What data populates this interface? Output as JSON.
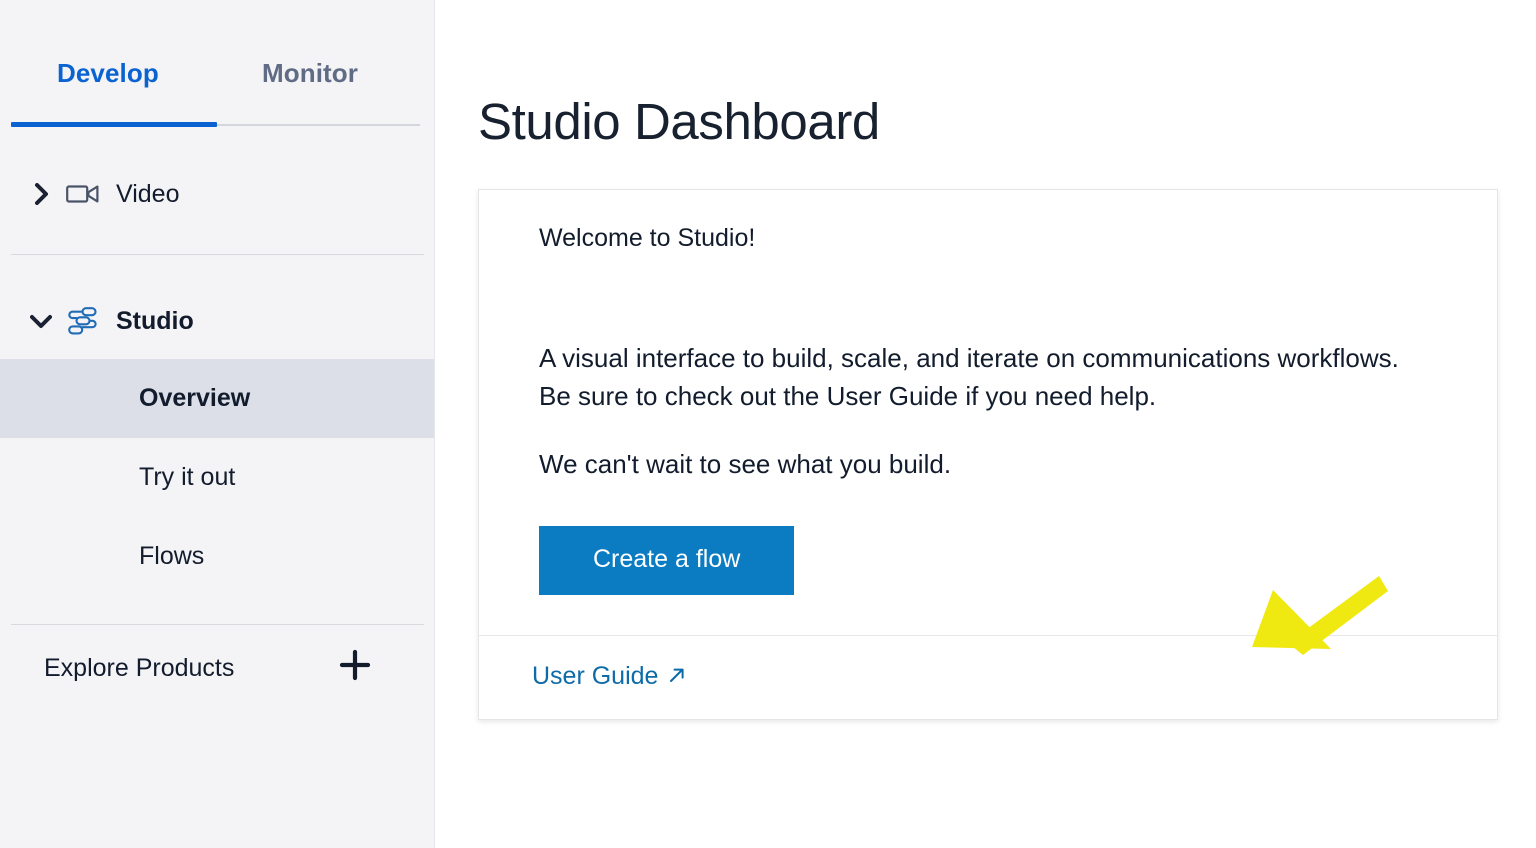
{
  "sidebar": {
    "tabs": [
      {
        "label": "Develop",
        "active": true
      },
      {
        "label": "Monitor",
        "active": false
      }
    ],
    "nav": [
      {
        "label": "Video",
        "icon": "video-camera-icon",
        "expanded": false
      },
      {
        "label": "Studio",
        "icon": "studio-flow-icon",
        "expanded": true
      }
    ],
    "studio_items": [
      {
        "label": "Overview",
        "active": true
      },
      {
        "label": "Try it out",
        "active": false
      },
      {
        "label": "Flows",
        "active": false
      }
    ],
    "explore": {
      "label": "Explore Products",
      "add_icon": "plus-icon"
    }
  },
  "main": {
    "page_title": "Studio Dashboard",
    "card": {
      "welcome": "Welcome to Studio!",
      "paragraph_1": "A visual interface to build, scale, and iterate on communications workflows. Be sure to check out the User Guide if you need help.",
      "paragraph_2": "We can't wait to see what you build.",
      "cta_label": "Create a flow",
      "footer_link_label": "User Guide",
      "footer_link_icon": "external-link-arrow-icon"
    }
  },
  "annotation": {
    "name": "highlight-arrow",
    "points_at": "Create a flow",
    "color": "#f0e811"
  },
  "colors": {
    "accent_blue": "#0a62d0",
    "button_blue": "#0b7bc2",
    "link_blue": "#0d6ba8",
    "sidebar_bg": "#f4f4f6",
    "active_row_bg": "#dcdfe8",
    "text_dark": "#121c2d",
    "muted_tab": "#606b85",
    "annotation_yellow": "#f0e811"
  }
}
